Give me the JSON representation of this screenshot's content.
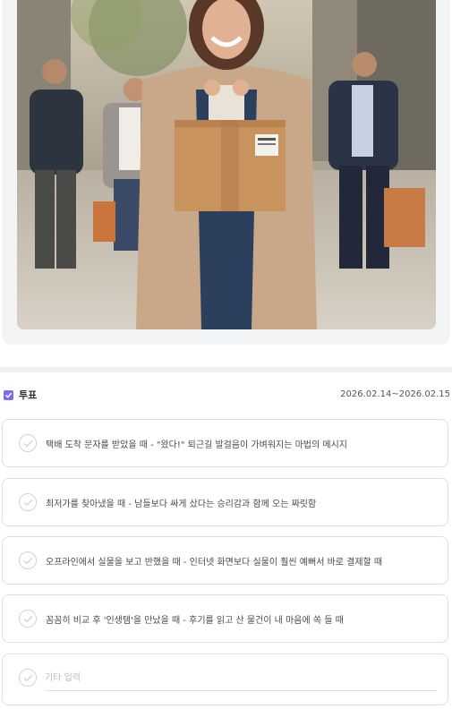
{
  "hero": {
    "image_name": "woman-holding-parcel-photo"
  },
  "poll": {
    "title": "투표",
    "date_range": "2026.02.14~2026.02.15",
    "accent_color": "#7b6cf0",
    "options": [
      {
        "label": "택배 도착 문자를 받았을 때 - \"왔다!\" 퇴근길 발걸음이 가벼워지는 마법의 메시지"
      },
      {
        "label": "최저가를 찾아냈을 때 - 남들보다 싸게 샀다는 승리감과 함께 오는 짜릿함"
      },
      {
        "label": "오프라인에서 실물을 보고 반했을 때 - 인터넷 화면보다 실물이 훨씬 예뻐서 바로 결제할 때"
      },
      {
        "label": "꼼꼼히 비교 후 '인생템'을 만났을 때 - 후기를 읽고 산 물건이 내 마음에 쏙 들 때"
      }
    ],
    "other": {
      "placeholder": "기타 입력",
      "value": ""
    }
  }
}
